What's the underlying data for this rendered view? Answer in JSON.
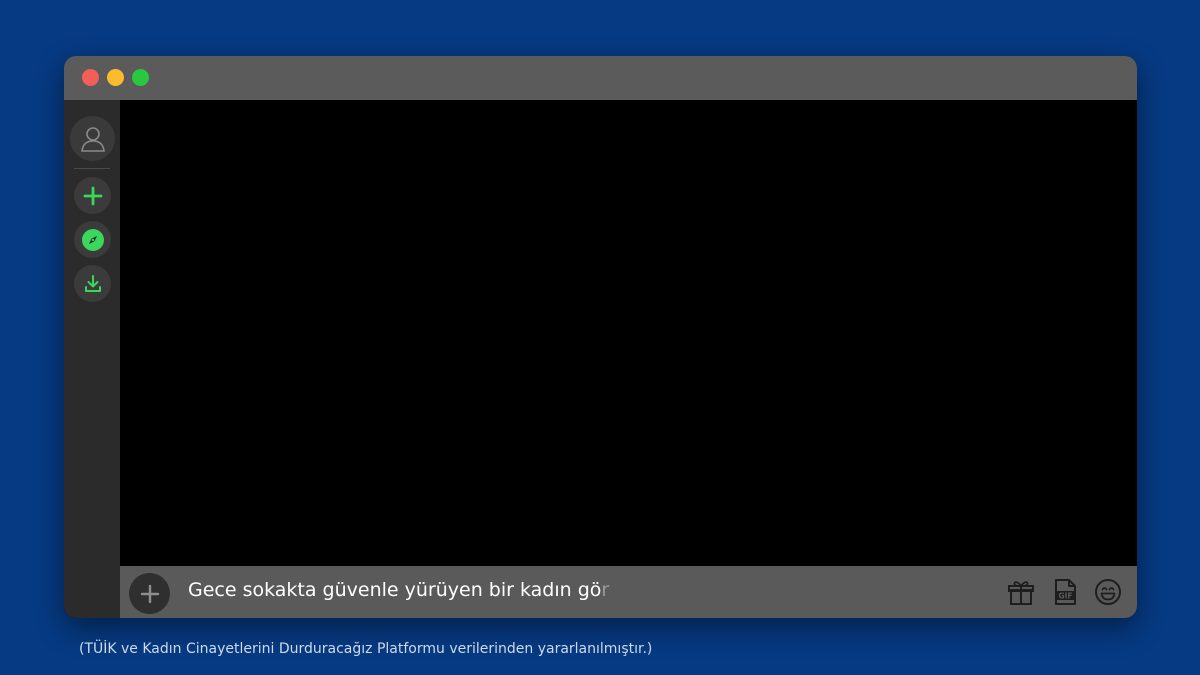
{
  "window": {
    "controls": [
      "close",
      "minimize",
      "maximize"
    ]
  },
  "sidebar": {
    "items": [
      {
        "name": "user-avatar",
        "icon": "user-icon"
      },
      {
        "name": "add-server",
        "icon": "plus-icon"
      },
      {
        "name": "explore",
        "icon": "compass-icon"
      },
      {
        "name": "download",
        "icon": "download-icon"
      }
    ]
  },
  "message_input": {
    "typed_text": "Gece sokakta güvenle yürüyen bir kadın gö",
    "typing_char": "r",
    "icons": [
      "gift-icon",
      "gif-icon",
      "emoji-icon"
    ],
    "gif_label": "GIF"
  },
  "caption": "(TÜİK ve Kadın Cinayetlerini Durduracağız Platformu verilerinden yararlanılmıştır.)",
  "colors": {
    "background": "#063a83",
    "accent_green": "#3bd65c",
    "titlebar": "#5b5b5b",
    "sidebar": "#2b2b2b",
    "inputbar": "#5a5a5a"
  }
}
